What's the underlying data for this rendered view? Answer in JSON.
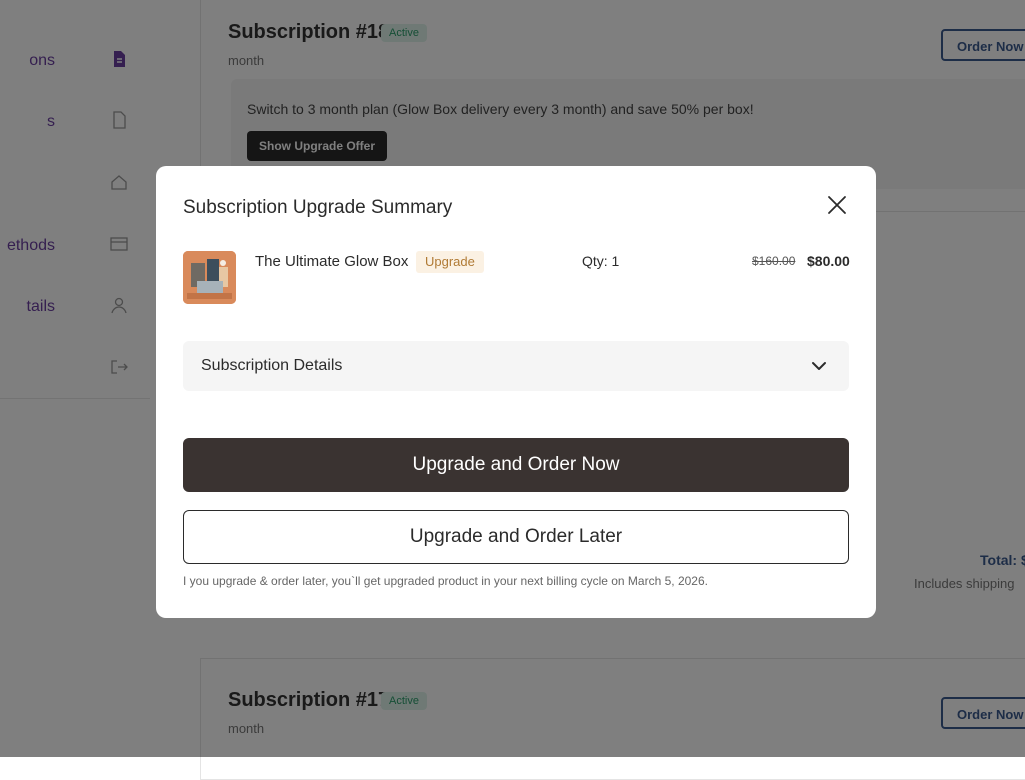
{
  "background": {
    "sidebar_items": [
      {
        "label": "ons",
        "icon": "document-icon"
      },
      {
        "label": "s",
        "icon": "file-icon"
      },
      {
        "label": "",
        "icon": "home-icon"
      },
      {
        "label": "ethods",
        "icon": "card-icon"
      },
      {
        "label": "tails",
        "icon": "user-icon"
      },
      {
        "label": "",
        "icon": "logout-icon"
      }
    ],
    "subscription_top": {
      "title": "Subscription #18",
      "status": "Active",
      "period": "month",
      "order_button": "Order Now",
      "offer_text": "Switch to 3 month plan (Glow Box delivery every 3 month) and save 50% per box!",
      "offer_button": "Show Upgrade Offer"
    },
    "total_label": "Total: $",
    "includes_label": "Includes shipping",
    "subscription_bottom": {
      "title": "Subscription #17",
      "status": "Active",
      "period": "month",
      "order_button": "Order Now"
    }
  },
  "modal": {
    "title": "Subscription Upgrade Summary",
    "close_icon": "close-icon",
    "product": {
      "name": "The Ultimate Glow Box",
      "badge": "Upgrade",
      "qty": "Qty: 1",
      "old_price": "$160.00",
      "new_price": "$80.00"
    },
    "details_label": "Subscription Details",
    "details_icon": "chevron-down-icon",
    "primary_button": "Upgrade and Order Now",
    "secondary_button": "Upgrade and Order Later",
    "note": "I you upgrade & order later, you`ll get upgraded product in your next billing cycle on March 5, 2026."
  },
  "colors": {
    "primary_button": "#3a3331",
    "upgrade_badge_bg": "#fbf1e3",
    "upgrade_badge_text": "#b07a34",
    "overlay": "rgba(0,0,0,0.5)"
  }
}
